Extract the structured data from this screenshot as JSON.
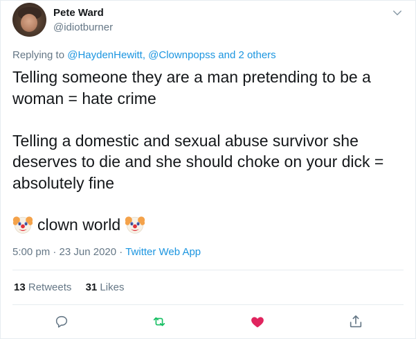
{
  "author": {
    "name": "Pete Ward",
    "handle": "@idiotburner"
  },
  "reply": {
    "prefix": "Replying to",
    "users": "@HaydenHewitt, @Clownpopss",
    "suffix": "and 2 others"
  },
  "tweet": {
    "line1": "Telling someone they are a man pretending to be a woman = hate crime",
    "line2": "Telling a domestic and sexual abuse survivor she deserves to die and she should choke on your dick = absolutely fine",
    "line3": "clown world"
  },
  "meta": {
    "timestamp": "5:00 pm · 23 Jun 2020",
    "separator": "·",
    "source": "Twitter Web App"
  },
  "stats": {
    "retweets_count": "13",
    "retweets_label": "Retweets",
    "likes_count": "31",
    "likes_label": "Likes"
  },
  "icons": {
    "caret": "chevron-down-icon",
    "reply": "reply-icon",
    "retweet": "retweet-icon",
    "like": "heart-icon",
    "share": "share-icon"
  },
  "colors": {
    "link": "#1b95e0",
    "muted": "#657786",
    "retweet": "#17bf63",
    "like": "#e0245e",
    "text": "#14171a"
  }
}
